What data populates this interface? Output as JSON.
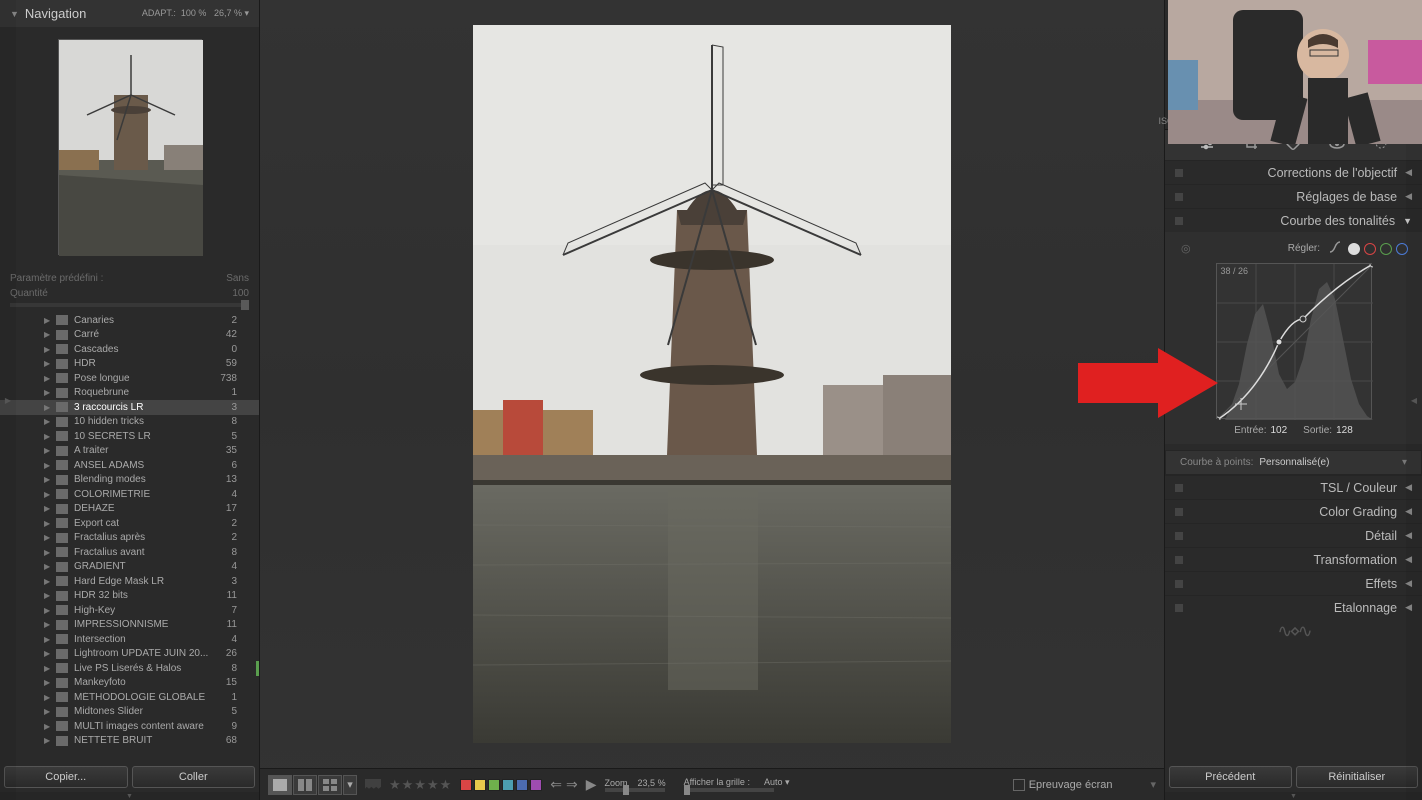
{
  "left": {
    "nav_title": "Navigation",
    "adapt_label": "ADAPT.:",
    "adapt_v1": "100 %",
    "adapt_v2": "26,7 %",
    "preset_label": "Paramètre prédéfini :",
    "preset_value": "Sans",
    "qty_label": "Quantité",
    "qty_value": "100",
    "folders": [
      {
        "name": "Canaries",
        "count": "2"
      },
      {
        "name": "Carré",
        "count": "42"
      },
      {
        "name": "Cascades",
        "count": "0"
      },
      {
        "name": "HDR",
        "count": "59"
      },
      {
        "name": "Pose longue",
        "count": "738"
      },
      {
        "name": "Roquebrune",
        "count": "1"
      },
      {
        "name": "3 raccourcis LR",
        "count": "3",
        "selected": true
      },
      {
        "name": "10 hidden tricks",
        "count": "8"
      },
      {
        "name": "10 SECRETS LR",
        "count": "5"
      },
      {
        "name": "A traiter",
        "count": "35"
      },
      {
        "name": "ANSEL ADAMS",
        "count": "6"
      },
      {
        "name": "Blending modes",
        "count": "13"
      },
      {
        "name": "COLORIMETRIE",
        "count": "4"
      },
      {
        "name": "DEHAZE",
        "count": "17"
      },
      {
        "name": "Export cat",
        "count": "2"
      },
      {
        "name": "Fractalius après",
        "count": "2"
      },
      {
        "name": "Fractalius avant",
        "count": "8"
      },
      {
        "name": "GRADIENT",
        "count": "4"
      },
      {
        "name": "Hard Edge Mask LR",
        "count": "3"
      },
      {
        "name": "HDR 32 bits",
        "count": "11"
      },
      {
        "name": "High-Key",
        "count": "7"
      },
      {
        "name": "IMPRESSIONNISME",
        "count": "11"
      },
      {
        "name": "Intersection",
        "count": "4"
      },
      {
        "name": "Lightroom UPDATE JUIN 20...",
        "count": "26"
      },
      {
        "name": "Live PS Liserés & Halos",
        "count": "8",
        "bar": "#5a9e4e"
      },
      {
        "name": "Mankeyfoto",
        "count": "15"
      },
      {
        "name": "MÉTHODOLOGIE GLOBALE",
        "count": "1"
      },
      {
        "name": "Midtones Slider",
        "count": "5"
      },
      {
        "name": "MULTI images content aware",
        "count": "9"
      },
      {
        "name": "NETTETE BRUIT",
        "count": "68"
      }
    ],
    "btn_copy": "Copier...",
    "btn_paste": "Coller"
  },
  "bottom": {
    "zoom_label": "Zoom",
    "zoom_value": "23,5 %",
    "grid_label": "Afficher la grille :",
    "grid_value": "Auto",
    "proof": "Epreuvage écran",
    "colors": [
      "#d94545",
      "#e8c94c",
      "#6fb04c",
      "#4c9eb0",
      "#4c6cb0",
      "#9e4cb0"
    ]
  },
  "right": {
    "iso": "ISO",
    "panels": {
      "lens": "Corrections de l'objectif",
      "basic": "Réglages de base",
      "tone": "Courbe des tonalités",
      "tsl": "TSL",
      "tsl2": " / Couleur",
      "grading": "Color Grading",
      "detail": "Détail",
      "transform": "Transformation",
      "effects": "Effets",
      "calib": "Etalonnage"
    },
    "tone_curve": {
      "adjust_label": "Régler:",
      "readout": "38 / 26",
      "input_label": "Entrée:",
      "input_value": "102",
      "output_label": "Sortie:",
      "output_value": "128",
      "point_label": "Courbe à points:",
      "point_value": "Personnalisé(e)"
    },
    "btn_prev": "Précédent",
    "btn_reset": "Réinitialiser"
  },
  "chart_data": {
    "type": "line",
    "note": "Tone curve (input→output) with background luminance histogram",
    "curve_points": [
      {
        "input": 0,
        "output": 0
      },
      {
        "input": 102,
        "output": 128
      },
      {
        "input": 140,
        "output": 165
      },
      {
        "input": 255,
        "output": 255
      }
    ],
    "xlim": [
      0,
      255
    ],
    "ylim": [
      0,
      255
    ],
    "histogram_bins": [
      0,
      0,
      0,
      0,
      2,
      5,
      12,
      25,
      45,
      78,
      95,
      70,
      42,
      28,
      22,
      30,
      55,
      88,
      110,
      98,
      65,
      40,
      22,
      12,
      6,
      3,
      1,
      0,
      0,
      0,
      0,
      0
    ],
    "readout": "38 / 26",
    "entree": 102,
    "sortie": 128
  }
}
